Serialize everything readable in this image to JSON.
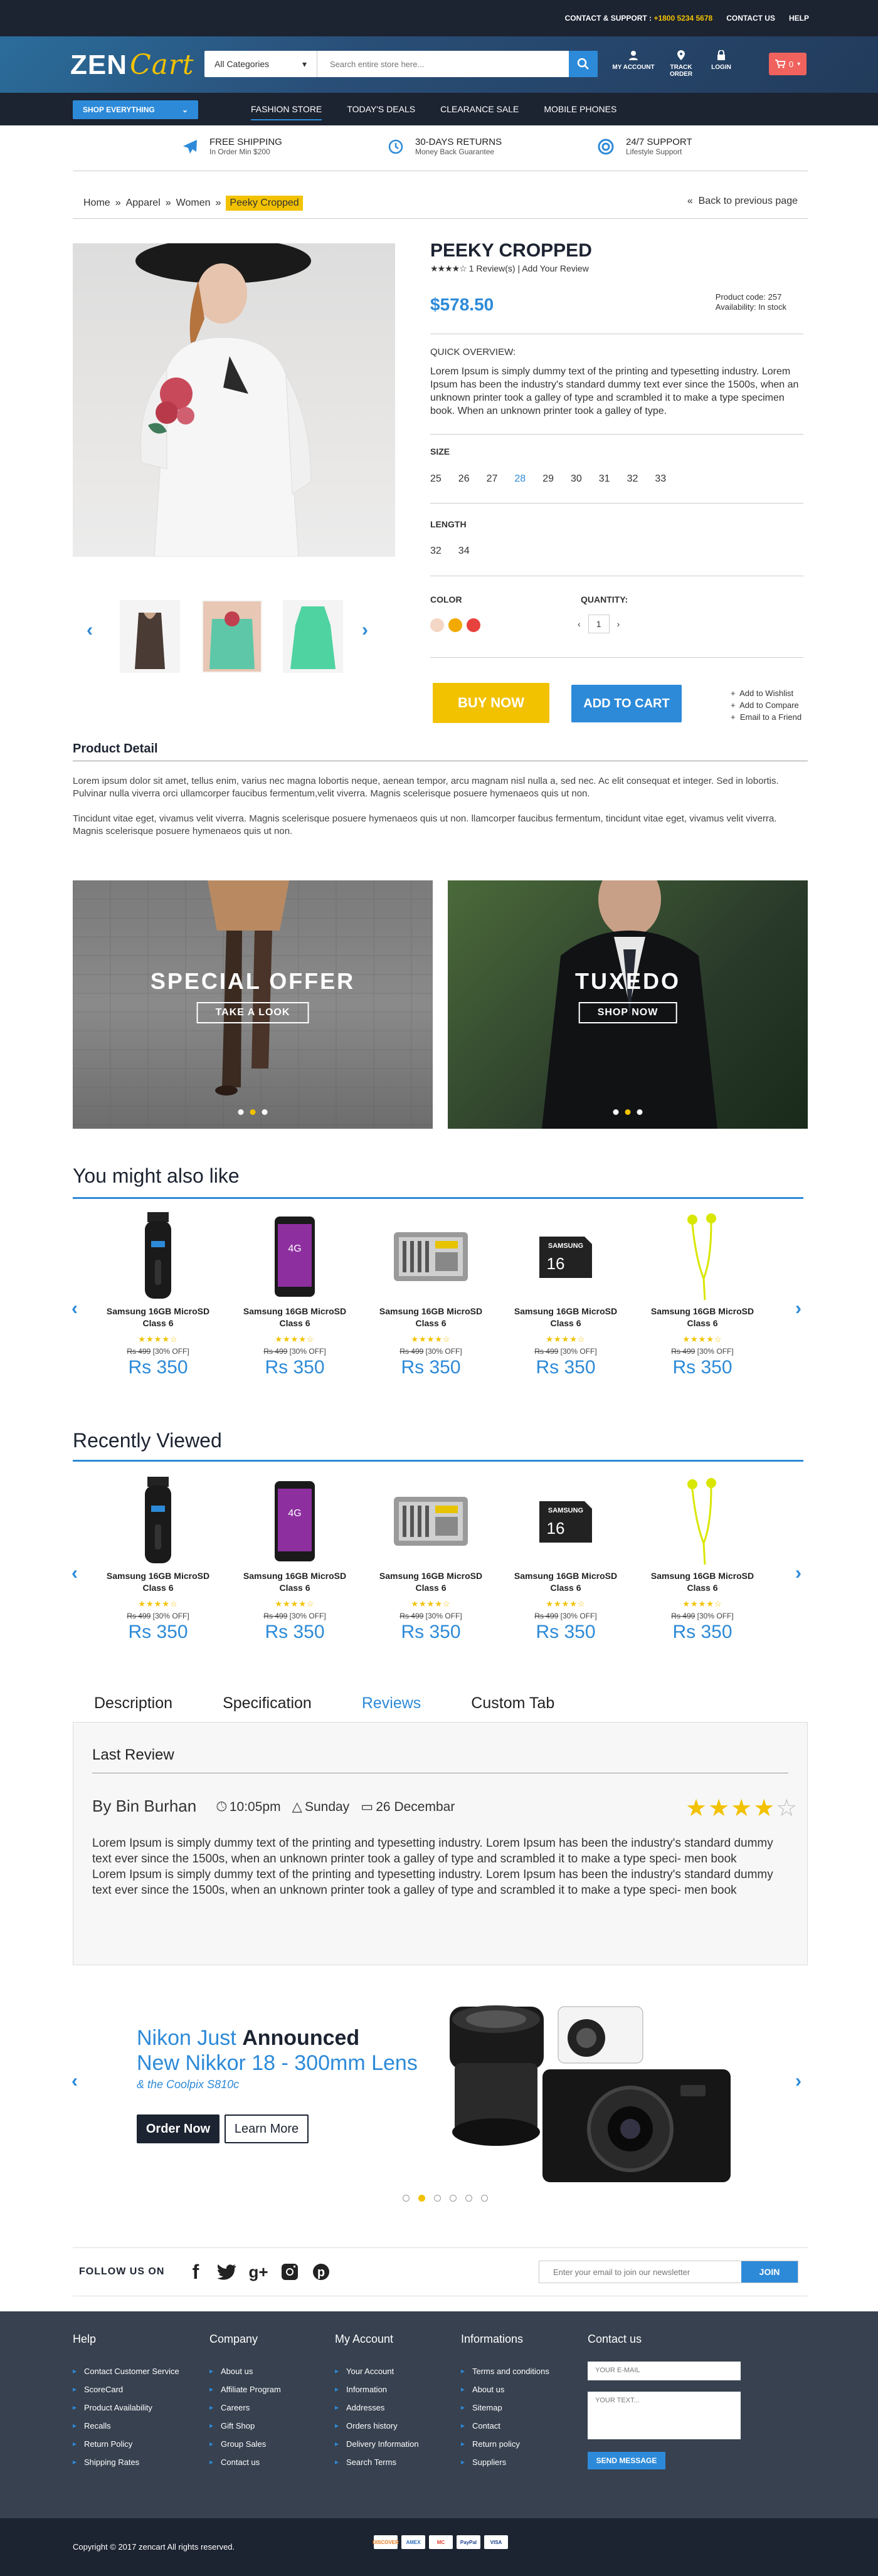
{
  "topbar": {
    "support_label": "CONTACT & SUPPORT :",
    "phone": "+1800 5234 5678",
    "contact": "CONTACT US",
    "help": "HELP"
  },
  "header": {
    "logo_zen": "ZEN",
    "logo_cart": "Cart",
    "category": "All Categories",
    "search_placeholder": "Search entire store here...",
    "my_account": "MY ACCOUNT",
    "track_order": "TRACK ORDER",
    "login": "LOGIN",
    "cart_count": "0"
  },
  "nav": {
    "shop_everything": "SHOP EVERYTHING",
    "items": [
      "FASHION STORE",
      "TODAY'S DEALS",
      "CLEARANCE SALE",
      "MOBILE PHONES"
    ],
    "active": 0
  },
  "features": [
    {
      "title": "FREE SHIPPING",
      "sub": "In Order Min $200",
      "icon": "plane-icon"
    },
    {
      "title": "30-DAYS RETURNS",
      "sub": "Money Back Guarantee",
      "icon": "clock-icon"
    },
    {
      "title": "24/7 SUPPORT",
      "sub": "Lifestyle Support",
      "icon": "lifebuoy-icon"
    }
  ],
  "breadcrumb": {
    "items": [
      "Home",
      "Apparel",
      "Women"
    ],
    "current": "Peeky Cropped",
    "back": "Back to previous page"
  },
  "product": {
    "title": "PEEKY CROPPED",
    "rating": 4,
    "reviews": "1 Review(s) | Add Your Review",
    "price": "$578.50",
    "code": "Product code: 257",
    "availability": "Availability: In stock",
    "overview_label": "QUICK OVERVIEW:",
    "overview": "Lorem Ipsum is simply dummy text of the printing and typesetting industry. Lorem Ipsum has been the industry's standard dummy text ever since the 1500s, when an unknown printer took a galley of type and scrambled it to make a type specimen book. When an unknown printer took a galley of type.",
    "size_label": "SIZE",
    "sizes": [
      "25",
      "26",
      "27",
      "28",
      "29",
      "30",
      "31",
      "32",
      "33"
    ],
    "selected_size": "28",
    "length_label": "LENGTH",
    "lengths": [
      "32",
      "34"
    ],
    "color_label": "COLOR",
    "colors": [
      "#f4d6c4",
      "#f2a900",
      "#e8423f"
    ],
    "quantity_label": "QUANTITY:",
    "quantity": "1",
    "buy_now": "BUY NOW",
    "add_to_cart": "ADD TO CART",
    "links": [
      "Add to Wishlist",
      "Add to Compare",
      "Email to a Friend"
    ]
  },
  "detail": {
    "title": "Product Detail",
    "p1": "Lorem ipsum dolor sit amet, tellus enim, varius nec magna lobortis neque, aenean tempor, arcu magnam nisl nulla a, sed nec. Ac elit consequat et integer. Sed in lobortis. Pulvinar nulla viverra orci ullamcorper faucibus fermentum,velit viverra. Magnis scelerisque posuere hymenaeos quis ut non.",
    "p2": "Tincidunt vitae eget, vivamus velit viverra. Magnis scelerisque posuere hymenaeos quis ut non. llamcorper faucibus fermentum, tincidunt vitae eget, vivamus velit viverra. Magnis scelerisque posuere hymenaeos quis ut non."
  },
  "banners": [
    {
      "title": "SPECIAL OFFER",
      "button": "TAKE A LOOK"
    },
    {
      "title": "TUXEDO",
      "button": "SHOP NOW"
    }
  ],
  "also_like": {
    "title": "You might also like"
  },
  "recent": {
    "title": "Recently Viewed"
  },
  "products": [
    {
      "name": "Samsung 16GB MicroSD Class 6",
      "old": "Rs 499",
      "off": "[30% OFF]",
      "price": "Rs 350",
      "icon": "trimmer-icon"
    },
    {
      "name": "Samsung 16GB MicroSD Class 6",
      "old": "Rs 499",
      "off": "[30% OFF]",
      "price": "Rs 350",
      "icon": "phone-icon"
    },
    {
      "name": "Samsung 16GB MicroSD Class 6",
      "old": "Rs 499",
      "off": "[30% OFF]",
      "price": "Rs 350",
      "icon": "toolkit-icon"
    },
    {
      "name": "Samsung 16GB MicroSD Class 6",
      "old": "Rs 499",
      "off": "[30% OFF]",
      "price": "Rs 350",
      "icon": "sdcard-icon"
    },
    {
      "name": "Samsung 16GB MicroSD Class 6",
      "old": "Rs 499",
      "off": "[30% OFF]",
      "price": "Rs 350",
      "icon": "earphones-icon"
    }
  ],
  "product_stars": "★★★★☆",
  "sdcard": {
    "brand": "SAMSUNG",
    "cap": "16"
  },
  "phone_label": "4G",
  "tabs": {
    "items": [
      "Description",
      "Specification",
      "Reviews",
      "Custom Tab"
    ],
    "active": 2
  },
  "review": {
    "title": "Last Review",
    "author": "By Bin Burhan",
    "time": "10:05pm",
    "day": "Sunday",
    "date": "26 Decembar",
    "rating": 4,
    "p1": "Lorem Ipsum is simply dummy text of the printing and typesetting industry. Lorem Ipsum has been the industry's standard dummy text ever since the 1500s, when an unknown printer took a galley of type and scrambled it to make a type speci- men book",
    "p2": "Lorem Ipsum is simply dummy text of the printing and typesetting industry. Lorem Ipsum has been the industry's standard dummy text ever since the 1500s, when an unknown printer took a galley of type and scrambled it to make a type speci- men book"
  },
  "camera_banner": {
    "line1_a": "Nikon Just ",
    "line1_b": "Announced",
    "line2": "New Nikkor 18 - 300mm Lens",
    "sub": "& the Coolpix S810c",
    "order": "Order Now",
    "learn": "Learn More",
    "slides": 6,
    "active_slide": 1
  },
  "follow": {
    "label": "FOLLOW US ON",
    "icons": [
      "facebook-icon",
      "twitter-icon",
      "googleplus-icon",
      "instagram-icon",
      "pinterest-icon"
    ],
    "newsletter_placeholder": "Enter your email to join our newsletter",
    "join": "JOIN"
  },
  "footer": {
    "help": {
      "title": "Help",
      "items": [
        "Contact Customer Service",
        "ScoreCard",
        "Product Availability",
        "Recalls",
        "Return Policy",
        "Shipping Rates"
      ]
    },
    "company": {
      "title": "Company",
      "items": [
        "About us",
        "Affiliate Program",
        "Careers",
        "Gift Shop",
        "Group Sales",
        "Contact us"
      ]
    },
    "account": {
      "title": "My Account",
      "items": [
        "Your Account",
        "Information",
        "Addresses",
        "Orders history",
        "Delivery Information",
        "Search Terms"
      ]
    },
    "info": {
      "title": "Informations",
      "items": [
        "Terms and conditions",
        "About us",
        "Sitemap",
        "Contact",
        "Return policy",
        "Suppliers"
      ]
    },
    "contact": {
      "title": "Contact us",
      "email_placeholder": "YOUR E-MAIL",
      "text_placeholder": "YOUR TEXT...",
      "send": "SEND MESSAGE"
    }
  },
  "copyright": "Copyright © 2017 zencart All rights reserved.",
  "payments": [
    "DISCOVER",
    "AMEX",
    "MC",
    "PayPal",
    "VISA"
  ]
}
